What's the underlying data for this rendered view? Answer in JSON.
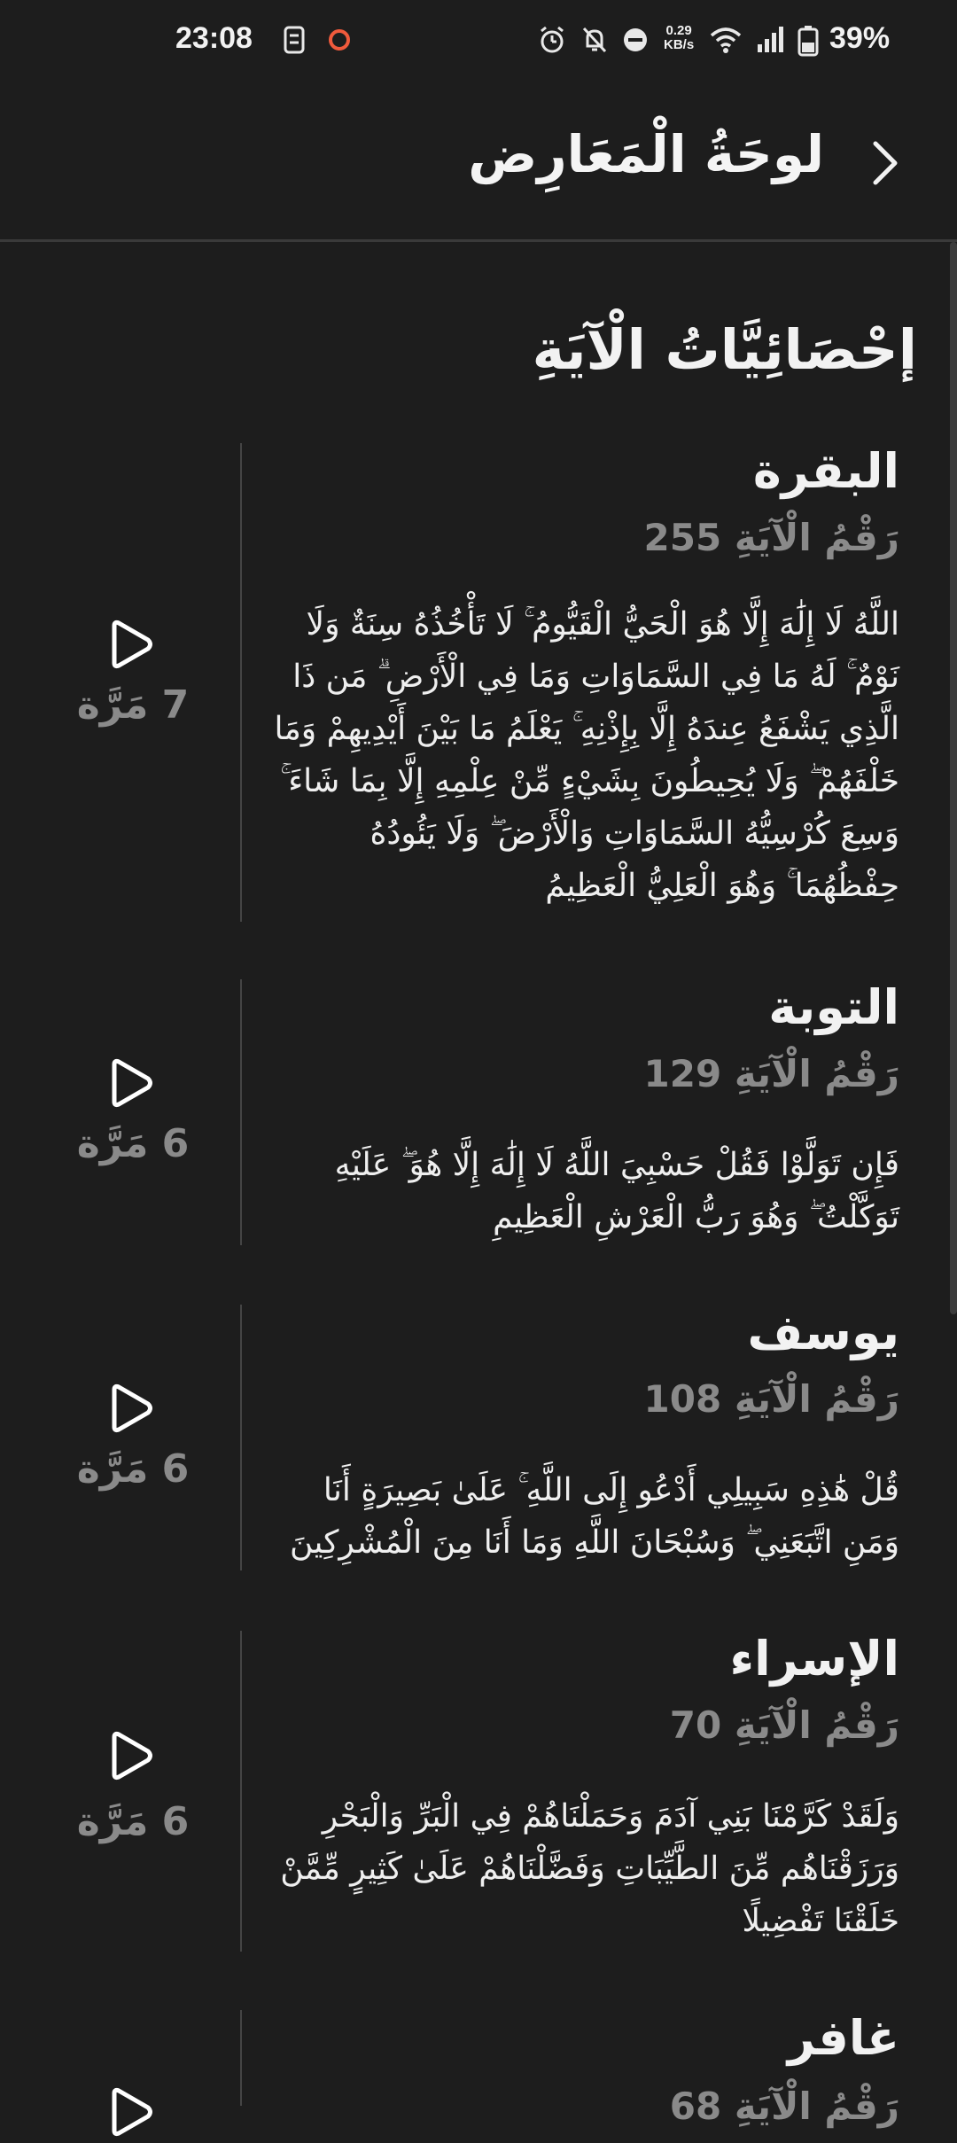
{
  "status_bar": {
    "time": "23:08",
    "net_speed_value": "0.29",
    "net_speed_unit": "KB/s",
    "battery": "39%",
    "icons": [
      "sim-icon",
      "record-icon",
      "alarm-icon",
      "mute-icon",
      "dnd-icon",
      "wifi-icon",
      "signal-icon",
      "battery-icon"
    ]
  },
  "header": {
    "title": "لوحَةُ الْمَعَارِض",
    "back_icon": "chevron-right-icon"
  },
  "section": {
    "title": "إحْصَائِيَّاتُ الْآيَةِ"
  },
  "colors": {
    "background": "#1d1d1d",
    "text": "#ececec",
    "muted": "#8a8a8a",
    "divider": "#3a3a3a"
  },
  "cards": [
    {
      "surah": "البقرة",
      "ayah_label": "رَقْمُ الْآيَةِ 255",
      "text": "اللَّهُ لَا إِلَٰهَ إِلَّا هُوَ الْحَيُّ الْقَيُّومُ ۚ لَا تَأْخُذُهُ سِنَةٌ وَلَا نَوْمٌ ۚ لَهُ مَا فِي السَّمَاوَاتِ وَمَا فِي الْأَرْضِ ۗ مَن ذَا الَّذِي يَشْفَعُ عِندَهُ إِلَّا بِإِذْنِهِ ۚ يَعْلَمُ مَا بَيْنَ أَيْدِيهِمْ وَمَا خَلْفَهُمْ ۖ وَلَا يُحِيطُونَ بِشَيْءٍ مِّنْ عِلْمِهِ إِلَّا بِمَا شَاءَ ۚ وَسِعَ كُرْسِيُّهُ السَّمَاوَاتِ وَالْأَرْضَ ۖ وَلَا يَئُودُهُ حِفْظُهُمَا ۚ وَهُوَ الْعَلِيُّ الْعَظِيمُ",
      "count": "7 مَرَّة"
    },
    {
      "surah": "التوبة",
      "ayah_label": "رَقْمُ الْآيَةِ 129",
      "text": "فَإِن تَوَلَّوْا فَقُلْ حَسْبِيَ اللَّهُ لَا إِلَٰهَ إِلَّا هُوَ ۖ عَلَيْهِ تَوَكَّلْتُ ۖ وَهُوَ رَبُّ الْعَرْشِ الْعَظِيمِ",
      "count": "6 مَرَّة"
    },
    {
      "surah": "يوسف",
      "ayah_label": "رَقْمُ الْآيَةِ 108",
      "text": "قُلْ هَٰذِهِ سَبِيلِي أَدْعُو إِلَى اللَّهِ ۚ عَلَىٰ بَصِيرَةٍ أَنَا وَمَنِ اتَّبَعَنِي ۖ وَسُبْحَانَ اللَّهِ وَمَا أَنَا مِنَ الْمُشْرِكِينَ",
      "count": "6 مَرَّة"
    },
    {
      "surah": "الإسراء",
      "ayah_label": "رَقْمُ الْآيَةِ 70",
      "text": "وَلَقَدْ كَرَّمْنَا بَنِي آدَمَ وَحَمَلْنَاهُمْ فِي الْبَرِّ وَالْبَحْرِ وَرَزَقْنَاهُم مِّنَ الطَّيِّبَاتِ وَفَضَّلْنَاهُمْ عَلَىٰ كَثِيرٍ مِّمَّنْ خَلَقْنَا تَفْضِيلًا",
      "count": "6 مَرَّة"
    },
    {
      "surah": "غافر",
      "ayah_label": "رَقْمُ الْآيَةِ 68",
      "text": "",
      "count": ""
    }
  ]
}
